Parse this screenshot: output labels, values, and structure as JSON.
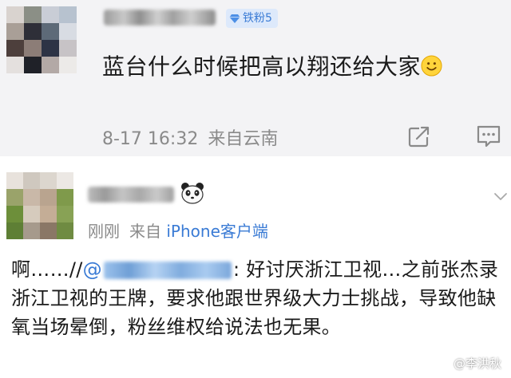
{
  "post": {
    "badge": "铁粉5",
    "text": "蓝台什么时候把高以翔还给大家",
    "timestamp": "8-17 16:32",
    "source": "来自云南"
  },
  "reply": {
    "time": "刚刚",
    "source_prefix": "来自",
    "source_device": "iPhone客户端",
    "text_start": "啊……//",
    "mention_at": "@",
    "text_body": ": 好讨厌浙江卫视…之前张杰录浙江卫视的王牌，要求他跟世界级大力士挑战，导致他缺氧当场晕倒，粉丝维权给说法也无果。"
  },
  "watermark": {
    "text": "@李洪秋"
  },
  "icons": {
    "badge": "diamond-icon",
    "post_emoji": "smile-emoji-icon",
    "share": "share-icon",
    "comment": "comment-icon",
    "reply_emoji": "panda-icon",
    "more": "chevron-down-icon",
    "watermark": "watermark-logo-icon"
  },
  "colors": {
    "link_blue": "#3a7bd5",
    "meta_gray": "#8a8a8a",
    "card_bg": "#f3f3f5",
    "badge_bg": "#dde9fb"
  }
}
